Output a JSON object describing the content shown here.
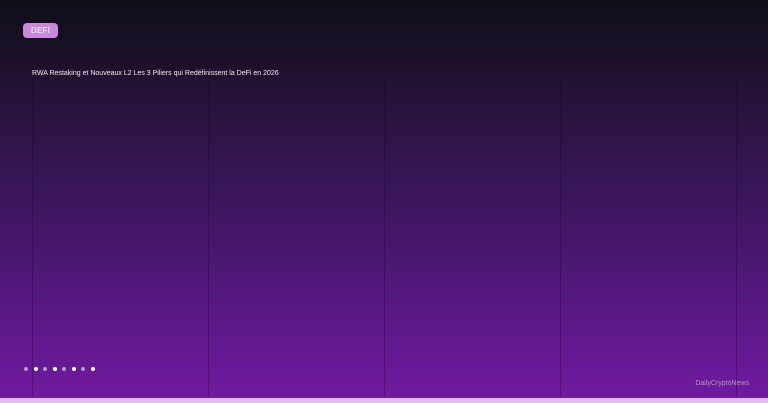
{
  "slide": {
    "category": "DEFI",
    "title": "RWA Restaking et Nouveaux L2 Les 3 Piliers qui Redéfinissent la DeFi en 2026"
  },
  "carousel": {
    "active_index": 5,
    "dots": [
      {
        "label": "slide 1"
      },
      {
        "label": "slide 2"
      },
      {
        "label": "slide 3"
      },
      {
        "label": "slide 4"
      },
      {
        "label": "slide 5"
      },
      {
        "label": "slide 6"
      },
      {
        "label": "slide 7"
      },
      {
        "label": "slide 8"
      }
    ]
  },
  "brand": {
    "name": "DailyCryptoNews"
  },
  "colors": {
    "accent": "#c68ad6",
    "gradient_top": "#0f0e18",
    "gradient_bottom": "#721aa2",
    "progress_bar": "#e0bdec"
  }
}
